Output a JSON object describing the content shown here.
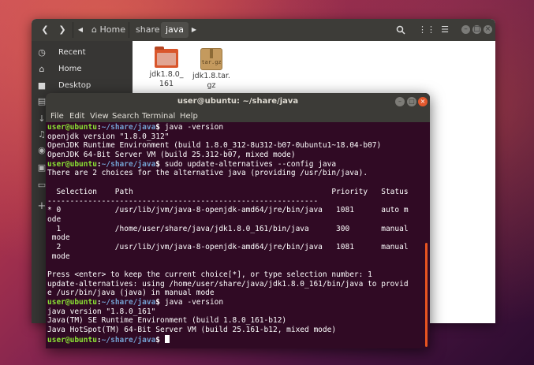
{
  "file_manager": {
    "breadcrumbs": [
      "Home",
      "share",
      "java"
    ],
    "sidebar": [
      {
        "label": "Recent",
        "icon": "clock-icon"
      },
      {
        "label": "Home",
        "icon": "home-icon"
      },
      {
        "label": "Desktop",
        "icon": "folder-icon"
      }
    ],
    "extra_sidebar_icons": [
      "document-icon",
      "download-icon",
      "music-icon",
      "picture-icon",
      "video-icon",
      "trash-icon",
      "plus-icon"
    ],
    "files": [
      {
        "name_line1": "jdk1.8.0_",
        "name_line2": "161",
        "icon": "folder-icon"
      },
      {
        "name_line1": "jdk1.8.tar.",
        "name_line2": "gz",
        "icon": "archive-icon",
        "badge": "tar.gz"
      }
    ]
  },
  "terminal": {
    "title": "user@ubuntu: ~/share/java",
    "menu": [
      "File",
      "Edit",
      "View",
      "Search",
      "Terminal",
      "Help"
    ],
    "prompt": {
      "user": "user@ubuntu",
      "sep": ":",
      "path": "~/share/java",
      "end": "$"
    },
    "lines": [
      {
        "type": "cmd",
        "text": " java -version"
      },
      {
        "type": "out",
        "text": "openjdk version \"1.8.0_312\""
      },
      {
        "type": "out",
        "text": "OpenJDK Runtime Environment (build 1.8.0_312-8u312-b07-0ubuntu1~18.04-b07)"
      },
      {
        "type": "out",
        "text": "OpenJDK 64-Bit Server VM (build 25.312-b07, mixed mode)"
      },
      {
        "type": "cmd",
        "text": " sudo update-alternatives --config java"
      },
      {
        "type": "out",
        "text": "There are 2 choices for the alternative java (providing /usr/bin/java)."
      },
      {
        "type": "out",
        "text": ""
      },
      {
        "type": "out",
        "text": "  Selection    Path                                            Priority   Status"
      },
      {
        "type": "out",
        "text": "------------------------------------------------------------"
      },
      {
        "type": "out",
        "text": "* 0            /usr/lib/jvm/java-8-openjdk-amd64/jre/bin/java   1081      auto m"
      },
      {
        "type": "out",
        "text": "ode"
      },
      {
        "type": "out",
        "text": "  1            /home/user/share/java/jdk1.8.0_161/bin/java      300       manual"
      },
      {
        "type": "out",
        "text": " mode"
      },
      {
        "type": "out",
        "text": "  2            /usr/lib/jvm/java-8-openjdk-amd64/jre/bin/java   1081      manual"
      },
      {
        "type": "out",
        "text": " mode"
      },
      {
        "type": "out",
        "text": ""
      },
      {
        "type": "out",
        "text": "Press <enter> to keep the current choice[*], or type selection number: 1"
      },
      {
        "type": "out",
        "text": "update-alternatives: using /home/user/share/java/jdk1.8.0_161/bin/java to provid"
      },
      {
        "type": "out",
        "text": "e /usr/bin/java (java) in manual mode"
      },
      {
        "type": "cmd",
        "text": " java -version"
      },
      {
        "type": "out",
        "text": "java version \"1.8.0_161\""
      },
      {
        "type": "out",
        "text": "Java(TM) SE Runtime Environment (build 1.8.0_161-b12)"
      },
      {
        "type": "out",
        "text": "Java HotSpot(TM) 64-Bit Server VM (build 25.161-b12, mixed mode)"
      },
      {
        "type": "cmd",
        "text": " ",
        "cursor": true
      }
    ]
  },
  "colors": {
    "terminal_bg": "#300a24",
    "prompt_user": "#8ae234",
    "prompt_path": "#729fcf",
    "accent": "#e95420"
  }
}
